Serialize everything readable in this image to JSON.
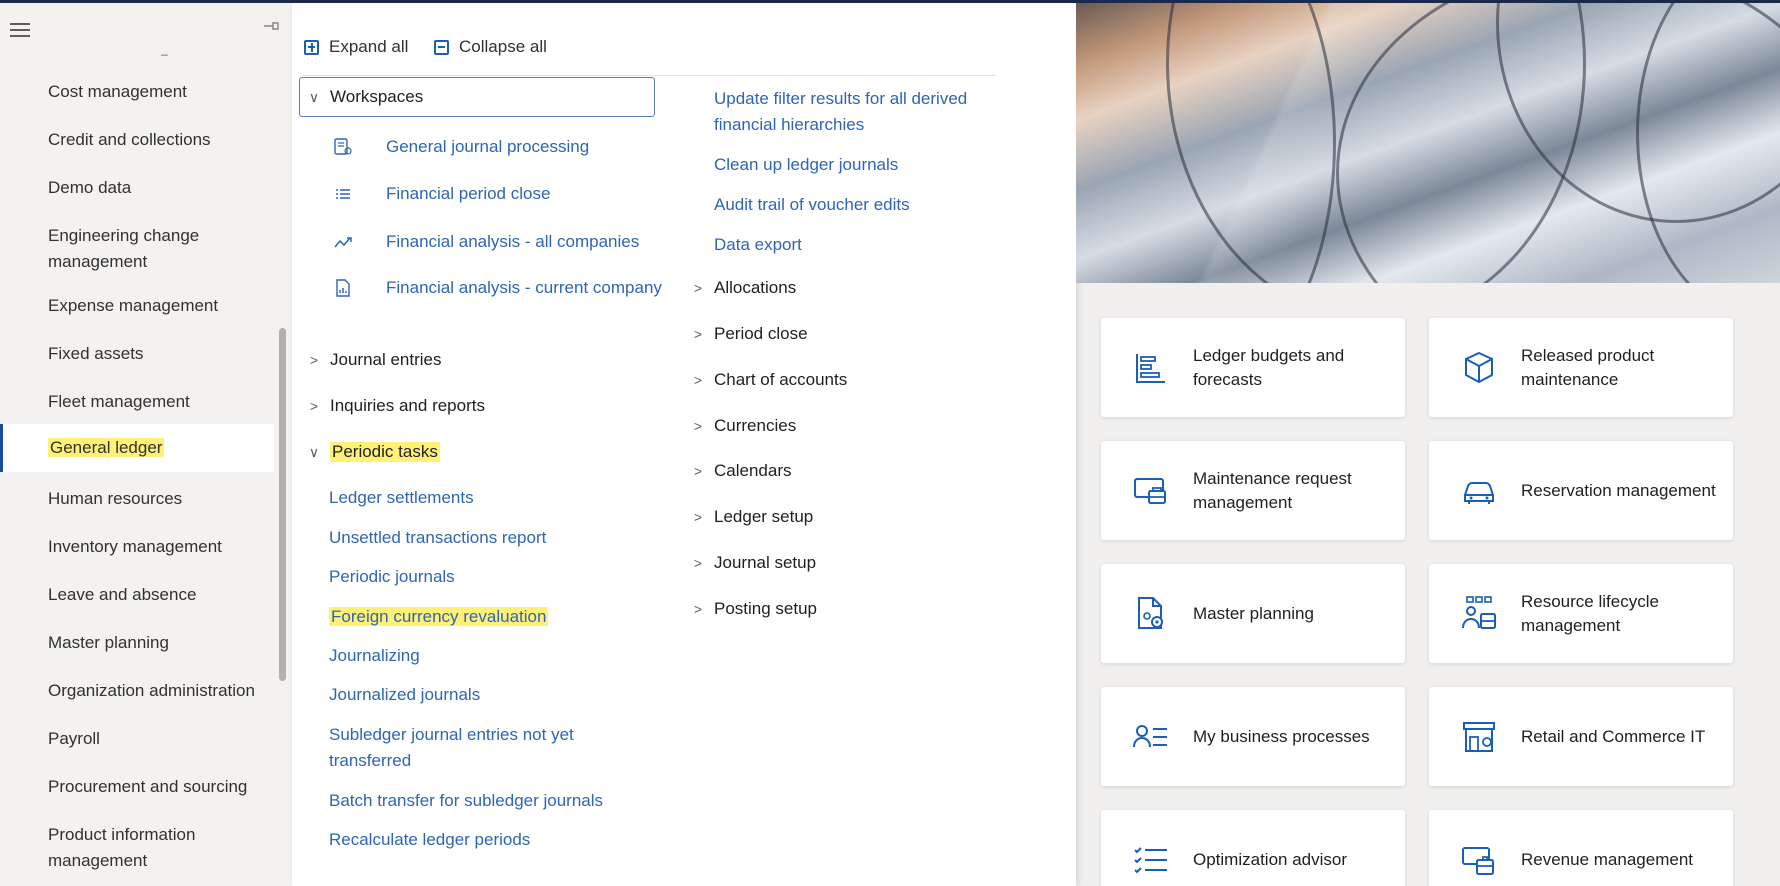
{
  "left_nav": {
    "items": [
      {
        "label": "Cost management"
      },
      {
        "label": "Credit and collections"
      },
      {
        "label": "Demo data"
      },
      {
        "label": "Engineering change management"
      },
      {
        "label": "Expense management"
      },
      {
        "label": "Fixed assets"
      },
      {
        "label": "Fleet management"
      },
      {
        "label": "General ledger",
        "active": true,
        "highlighted": true
      },
      {
        "label": "Human resources"
      },
      {
        "label": "Inventory management"
      },
      {
        "label": "Leave and absence"
      },
      {
        "label": "Master planning"
      },
      {
        "label": "Organization administration"
      },
      {
        "label": "Payroll"
      },
      {
        "label": "Procurement and sourcing"
      },
      {
        "label": "Product information management"
      }
    ]
  },
  "toolbar": {
    "expand_all": "Expand all",
    "collapse_all": "Collapse all"
  },
  "workspaces": {
    "label": "Workspaces",
    "items": [
      {
        "label": "General journal processing",
        "icon": "journal-icon"
      },
      {
        "label": "Financial period close",
        "icon": "list-icon"
      },
      {
        "label": "Financial analysis - all companies",
        "icon": "trend-icon"
      },
      {
        "label": "Financial analysis - current company",
        "icon": "report-icon"
      }
    ]
  },
  "groups_col1": {
    "journal_entries": "Journal entries",
    "inquiries": "Inquiries and reports",
    "periodic": "Periodic tasks"
  },
  "periodic_tasks": [
    "Ledger settlements",
    "Unsettled transactions report",
    "Periodic journals",
    "Foreign currency revaluation",
    "Journalizing",
    "Journalized journals",
    "Subledger journal entries not yet transferred",
    "Batch transfer for subledger journals",
    "Recalculate ledger periods"
  ],
  "col2_links": [
    "Update filter results for all derived financial hierarchies",
    "Clean up ledger journals",
    "Audit trail of voucher edits",
    "Data export"
  ],
  "col2_groups": [
    "Allocations",
    "Period close",
    "Chart of accounts",
    "Currencies",
    "Calendars",
    "Ledger setup",
    "Journal setup",
    "Posting setup"
  ],
  "tiles": [
    {
      "label": "Ledger budgets and forecasts",
      "icon": "budget-icon"
    },
    {
      "label": "Released product maintenance",
      "icon": "cube-icon"
    },
    {
      "label": "Maintenance request management",
      "icon": "maintenance-icon"
    },
    {
      "label": "Reservation management",
      "icon": "car-icon"
    },
    {
      "label": "Master planning",
      "icon": "planning-doc-icon"
    },
    {
      "label": "Resource lifecycle management",
      "icon": "people-icon"
    },
    {
      "label": "My business processes",
      "icon": "person-list-icon"
    },
    {
      "label": "Retail and Commerce IT",
      "icon": "store-icon"
    },
    {
      "label": "Optimization advisor",
      "icon": "checklist-icon"
    },
    {
      "label": "Revenue management",
      "icon": "revenue-icon"
    }
  ],
  "colors": {
    "link": "#2f64b6",
    "highlight": "#fff176",
    "accent": "#1b4c9c"
  }
}
